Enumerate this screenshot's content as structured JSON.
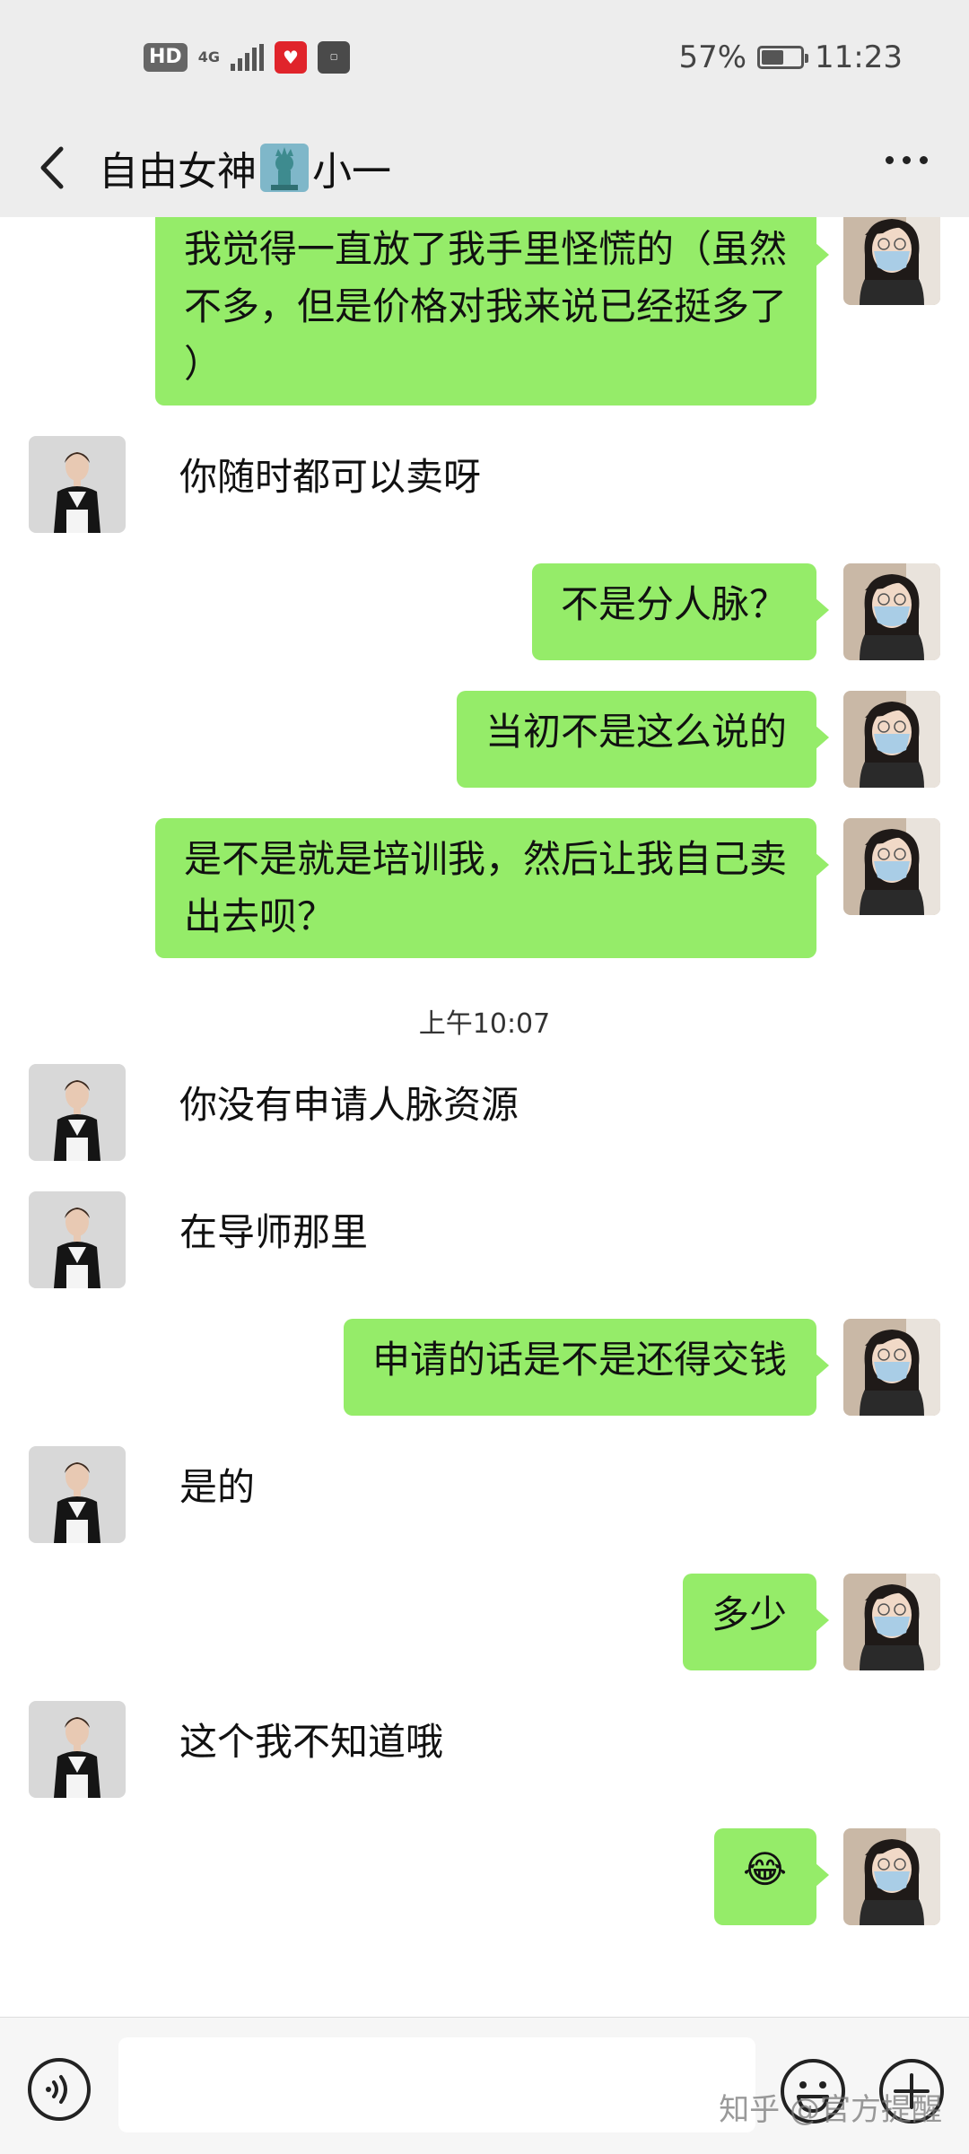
{
  "status_bar": {
    "hd_label": "HD",
    "network_label": "4G",
    "battery_percent": "57%",
    "battery_level": 0.57,
    "time": "11:23"
  },
  "header": {
    "title_before": "自由女神",
    "title_after": "小一",
    "title_emoji_name": "statue-of-liberty-icon"
  },
  "messages": [
    {
      "side": "right",
      "text": "我觉得一直放了我手里怪慌的（虽然不多，但是价格对我来说已经挺多了）"
    },
    {
      "side": "left",
      "text": "你随时都可以卖呀"
    },
    {
      "side": "right",
      "text": "不是分人脉？"
    },
    {
      "side": "right",
      "text": "当初不是这么说的"
    },
    {
      "side": "right",
      "text": "是不是就是培训我，然后让我自己卖出去呗？"
    },
    {
      "side": "time",
      "text": "上午10:07"
    },
    {
      "side": "left",
      "text": "你没有申请人脉资源"
    },
    {
      "side": "left",
      "text": "在导师那里"
    },
    {
      "side": "right",
      "text": "申请的话是不是还得交钱"
    },
    {
      "side": "left",
      "text": "是的"
    },
    {
      "side": "right",
      "text": "多少"
    },
    {
      "side": "left",
      "text": "这个我不知道哦"
    },
    {
      "side": "right",
      "text": "😂"
    }
  ],
  "input_bar": {
    "placeholder": "",
    "value": ""
  },
  "watermark": "知乎 @官方提醒",
  "colors": {
    "bubble_green": "#95ec69",
    "chrome_gray": "#ededed",
    "background": "#ffffff"
  }
}
